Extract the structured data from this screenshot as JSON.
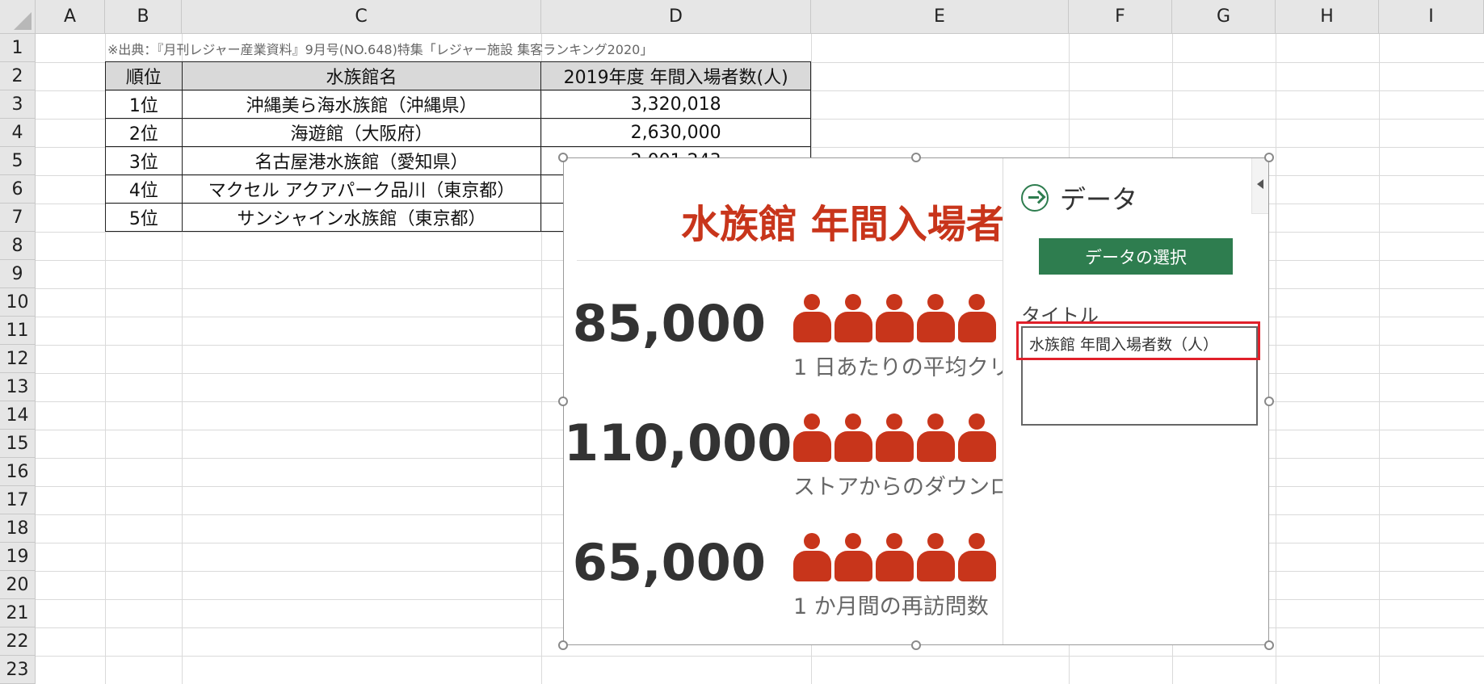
{
  "columns": [
    "A",
    "B",
    "C",
    "D",
    "E",
    "F",
    "G",
    "H",
    "I"
  ],
  "rows": [
    "1",
    "2",
    "3",
    "4",
    "5",
    "6",
    "7",
    "8",
    "9",
    "10",
    "11",
    "12",
    "13",
    "14",
    "15",
    "16",
    "17",
    "18",
    "19",
    "20",
    "21",
    "22",
    "23"
  ],
  "note": "※出典：『月刊レジャー産業資料』9月号(NO.648)特集「レジャー施設 集客ランキング2020」",
  "table": {
    "headers": [
      "順位",
      "水族館名",
      "2019年度 年間入場者数(人)"
    ],
    "rows": [
      [
        "1位",
        "沖縄美ら海水族館（沖縄県）",
        "3,320,018"
      ],
      [
        "2位",
        "海遊館（大阪府）",
        "2,630,000"
      ],
      [
        "3位",
        "名古屋港水族館（愛知県）",
        "2,001,243"
      ],
      [
        "4位",
        "マクセル アクアパーク品川（東京都）",
        ""
      ],
      [
        "5位",
        "サンシャイン水族館（東京都）",
        ""
      ]
    ]
  },
  "infographic": {
    "title": "水族館 年間入場者",
    "items": [
      {
        "number": "85,000",
        "caption": "1 日あたりの平均クリ"
      },
      {
        "number": "110,000",
        "caption": "ストアからのダウンロ"
      },
      {
        "number": "65,000",
        "caption": "1 か月間の再訪問数"
      }
    ],
    "accent": "#c8351b"
  },
  "pane": {
    "header": "データ",
    "select_button": "データの選択",
    "title_label": "タイトル",
    "title_value": "水族館 年間入場者数（人）",
    "accent": "#2e7d4f",
    "highlight": "#e0202a"
  }
}
